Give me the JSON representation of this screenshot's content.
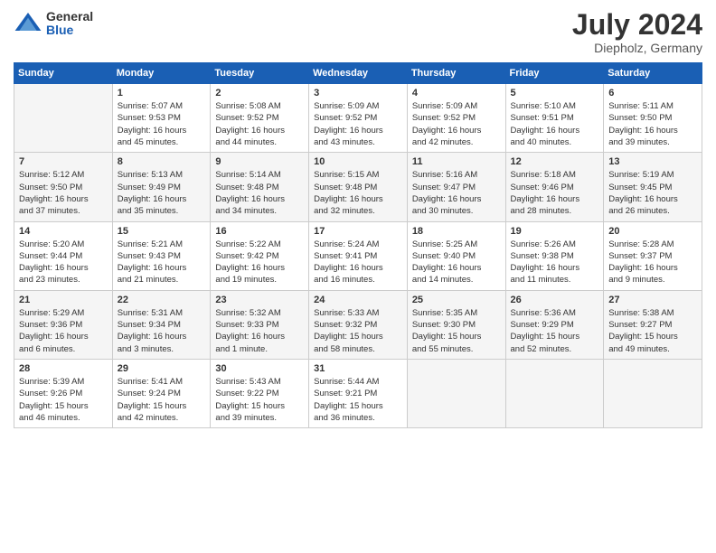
{
  "header": {
    "logo": {
      "general": "General",
      "blue": "Blue"
    },
    "title": "July 2024",
    "location": "Diepholz, Germany"
  },
  "calendar": {
    "columns": [
      "Sunday",
      "Monday",
      "Tuesday",
      "Wednesday",
      "Thursday",
      "Friday",
      "Saturday"
    ],
    "weeks": [
      [
        {
          "day": "",
          "info": ""
        },
        {
          "day": "1",
          "info": "Sunrise: 5:07 AM\nSunset: 9:53 PM\nDaylight: 16 hours\nand 45 minutes."
        },
        {
          "day": "2",
          "info": "Sunrise: 5:08 AM\nSunset: 9:52 PM\nDaylight: 16 hours\nand 44 minutes."
        },
        {
          "day": "3",
          "info": "Sunrise: 5:09 AM\nSunset: 9:52 PM\nDaylight: 16 hours\nand 43 minutes."
        },
        {
          "day": "4",
          "info": "Sunrise: 5:09 AM\nSunset: 9:52 PM\nDaylight: 16 hours\nand 42 minutes."
        },
        {
          "day": "5",
          "info": "Sunrise: 5:10 AM\nSunset: 9:51 PM\nDaylight: 16 hours\nand 40 minutes."
        },
        {
          "day": "6",
          "info": "Sunrise: 5:11 AM\nSunset: 9:50 PM\nDaylight: 16 hours\nand 39 minutes."
        }
      ],
      [
        {
          "day": "7",
          "info": "Sunrise: 5:12 AM\nSunset: 9:50 PM\nDaylight: 16 hours\nand 37 minutes."
        },
        {
          "day": "8",
          "info": "Sunrise: 5:13 AM\nSunset: 9:49 PM\nDaylight: 16 hours\nand 35 minutes."
        },
        {
          "day": "9",
          "info": "Sunrise: 5:14 AM\nSunset: 9:48 PM\nDaylight: 16 hours\nand 34 minutes."
        },
        {
          "day": "10",
          "info": "Sunrise: 5:15 AM\nSunset: 9:48 PM\nDaylight: 16 hours\nand 32 minutes."
        },
        {
          "day": "11",
          "info": "Sunrise: 5:16 AM\nSunset: 9:47 PM\nDaylight: 16 hours\nand 30 minutes."
        },
        {
          "day": "12",
          "info": "Sunrise: 5:18 AM\nSunset: 9:46 PM\nDaylight: 16 hours\nand 28 minutes."
        },
        {
          "day": "13",
          "info": "Sunrise: 5:19 AM\nSunset: 9:45 PM\nDaylight: 16 hours\nand 26 minutes."
        }
      ],
      [
        {
          "day": "14",
          "info": "Sunrise: 5:20 AM\nSunset: 9:44 PM\nDaylight: 16 hours\nand 23 minutes."
        },
        {
          "day": "15",
          "info": "Sunrise: 5:21 AM\nSunset: 9:43 PM\nDaylight: 16 hours\nand 21 minutes."
        },
        {
          "day": "16",
          "info": "Sunrise: 5:22 AM\nSunset: 9:42 PM\nDaylight: 16 hours\nand 19 minutes."
        },
        {
          "day": "17",
          "info": "Sunrise: 5:24 AM\nSunset: 9:41 PM\nDaylight: 16 hours\nand 16 minutes."
        },
        {
          "day": "18",
          "info": "Sunrise: 5:25 AM\nSunset: 9:40 PM\nDaylight: 16 hours\nand 14 minutes."
        },
        {
          "day": "19",
          "info": "Sunrise: 5:26 AM\nSunset: 9:38 PM\nDaylight: 16 hours\nand 11 minutes."
        },
        {
          "day": "20",
          "info": "Sunrise: 5:28 AM\nSunset: 9:37 PM\nDaylight: 16 hours\nand 9 minutes."
        }
      ],
      [
        {
          "day": "21",
          "info": "Sunrise: 5:29 AM\nSunset: 9:36 PM\nDaylight: 16 hours\nand 6 minutes."
        },
        {
          "day": "22",
          "info": "Sunrise: 5:31 AM\nSunset: 9:34 PM\nDaylight: 16 hours\nand 3 minutes."
        },
        {
          "day": "23",
          "info": "Sunrise: 5:32 AM\nSunset: 9:33 PM\nDaylight: 16 hours\nand 1 minute."
        },
        {
          "day": "24",
          "info": "Sunrise: 5:33 AM\nSunset: 9:32 PM\nDaylight: 15 hours\nand 58 minutes."
        },
        {
          "day": "25",
          "info": "Sunrise: 5:35 AM\nSunset: 9:30 PM\nDaylight: 15 hours\nand 55 minutes."
        },
        {
          "day": "26",
          "info": "Sunrise: 5:36 AM\nSunset: 9:29 PM\nDaylight: 15 hours\nand 52 minutes."
        },
        {
          "day": "27",
          "info": "Sunrise: 5:38 AM\nSunset: 9:27 PM\nDaylight: 15 hours\nand 49 minutes."
        }
      ],
      [
        {
          "day": "28",
          "info": "Sunrise: 5:39 AM\nSunset: 9:26 PM\nDaylight: 15 hours\nand 46 minutes."
        },
        {
          "day": "29",
          "info": "Sunrise: 5:41 AM\nSunset: 9:24 PM\nDaylight: 15 hours\nand 42 minutes."
        },
        {
          "day": "30",
          "info": "Sunrise: 5:43 AM\nSunset: 9:22 PM\nDaylight: 15 hours\nand 39 minutes."
        },
        {
          "day": "31",
          "info": "Sunrise: 5:44 AM\nSunset: 9:21 PM\nDaylight: 15 hours\nand 36 minutes."
        },
        {
          "day": "",
          "info": ""
        },
        {
          "day": "",
          "info": ""
        },
        {
          "day": "",
          "info": ""
        }
      ]
    ]
  }
}
